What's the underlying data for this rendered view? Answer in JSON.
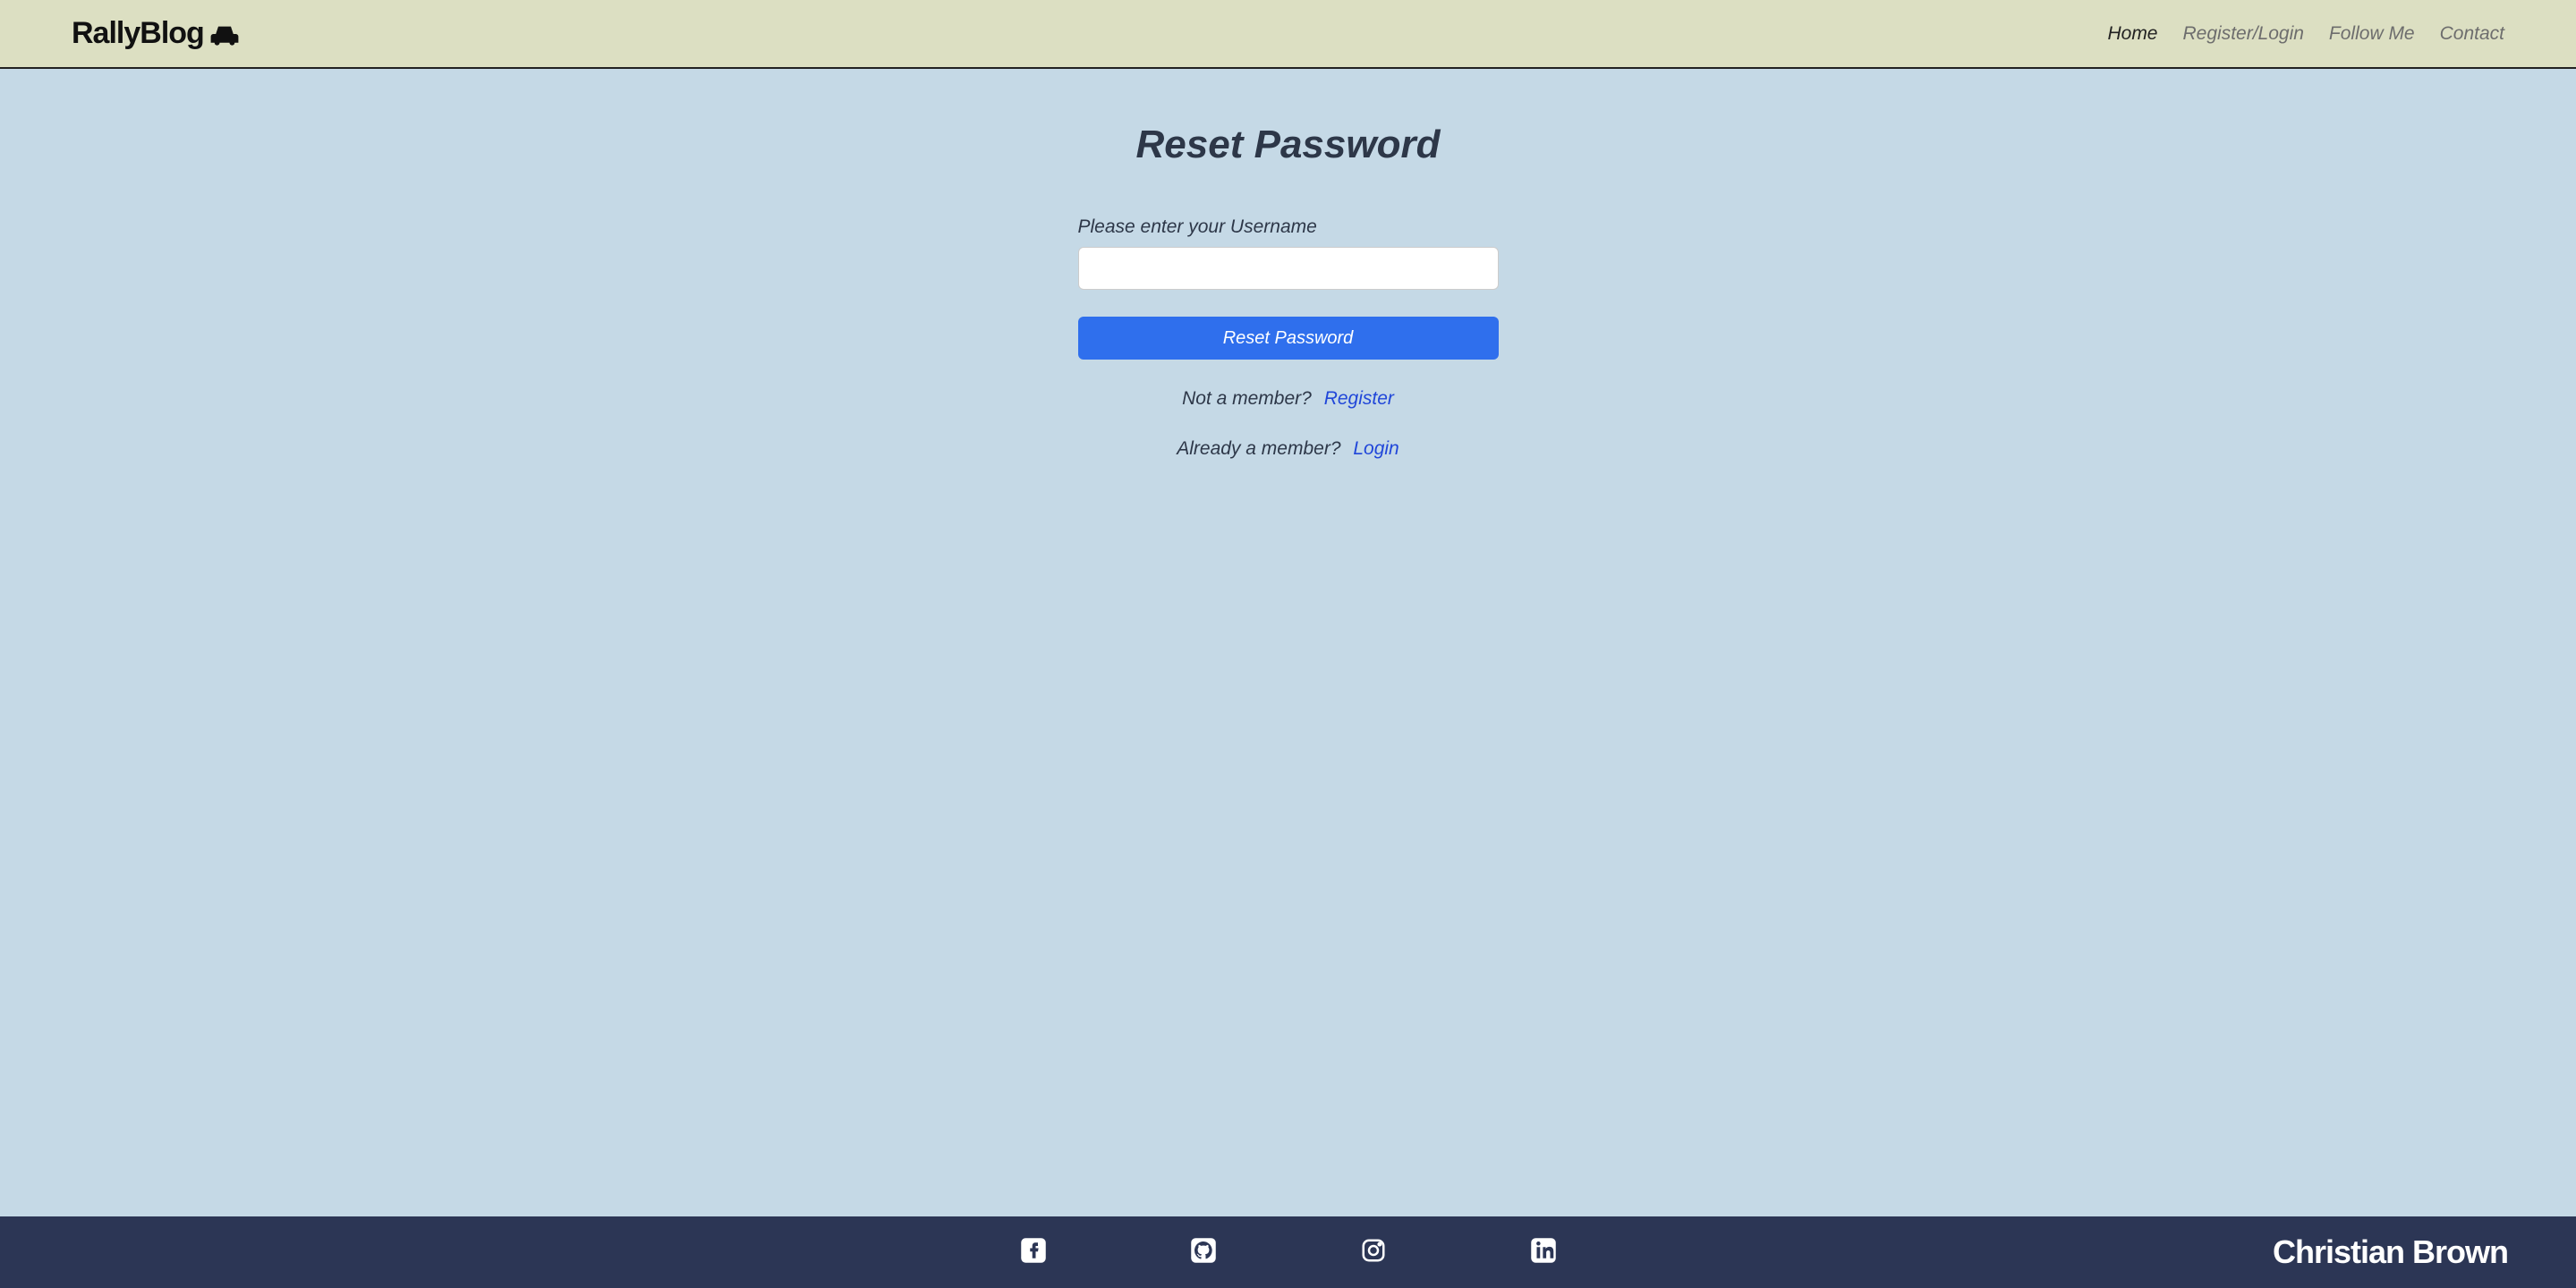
{
  "header": {
    "logo_text": "RallyBlog",
    "nav": [
      {
        "label": "Home",
        "active": true
      },
      {
        "label": "Register/Login",
        "active": false
      },
      {
        "label": "Follow Me",
        "active": false
      },
      {
        "label": "Contact",
        "active": false
      }
    ]
  },
  "form": {
    "title": "Reset Password",
    "username_label": "Please enter your Username",
    "username_value": "",
    "submit_label": "Reset Password",
    "not_member_text": "Not a member?",
    "register_link": "Register",
    "already_member_text": "Already a member?",
    "login_link": "Login"
  },
  "footer": {
    "social": [
      "facebook",
      "github",
      "instagram",
      "linkedin"
    ],
    "author": "Christian Brown"
  }
}
